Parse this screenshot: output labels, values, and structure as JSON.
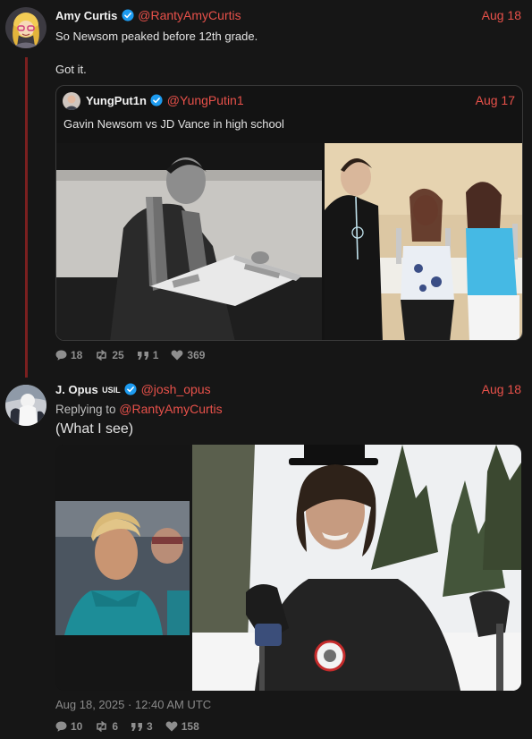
{
  "post1": {
    "name": "Amy Curtis",
    "handle": "@RantyAmyCurtis",
    "date": "Aug 18",
    "line1": "So Newsom peaked before 12th grade.",
    "line2": "Got it.",
    "stats": {
      "replies": "18",
      "reposts": "25",
      "quotes": "1",
      "likes": "369"
    }
  },
  "quote": {
    "name": "YungPut1n",
    "handle": "@YungPutin1",
    "date": "Aug 17",
    "text": "Gavin Newsom vs JD Vance in high school"
  },
  "post2": {
    "name": "J. Opus",
    "flag": "USIL",
    "handle": "@josh_opus",
    "date": "Aug 18",
    "replying_prefix": "Replying to ",
    "replying_to": "@RantyAmyCurtis",
    "text": "(What I see)",
    "timestamp": "Aug 18, 2025 · 12:40 AM UTC",
    "stats": {
      "replies": "10",
      "reposts": "6",
      "quotes": "3",
      "likes": "158"
    }
  },
  "colors": {
    "accent": "#e8514a",
    "background": "#161616",
    "verified": "#1d9bf0",
    "thread_line": "#7a1f1f"
  },
  "icons": [
    "verified-badge-icon",
    "reply-icon",
    "repost-icon",
    "quote-icon",
    "heart-icon"
  ]
}
